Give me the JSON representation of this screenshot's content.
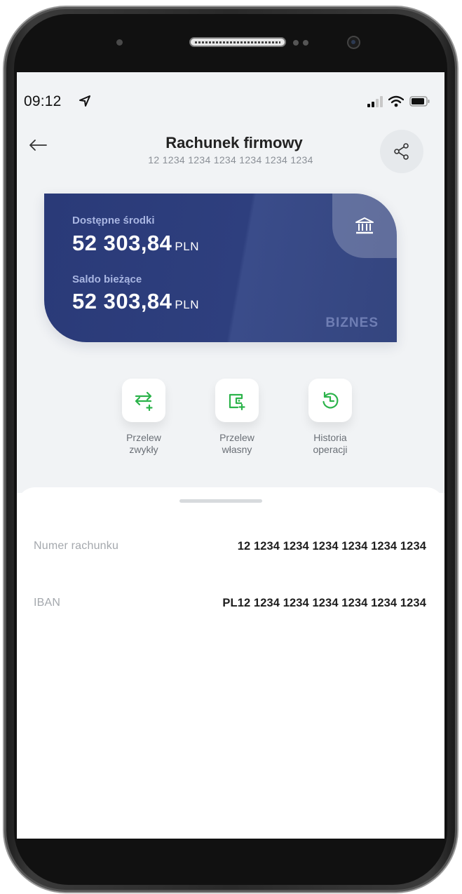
{
  "status_bar": {
    "time": "09:12"
  },
  "header": {
    "title": "Rachunek firmowy",
    "subtitle": "12 1234 1234 1234 1234 1234 1234"
  },
  "card": {
    "available_label": "Dostępne środki",
    "available_amount": "52 303,84",
    "available_currency": "PLN",
    "balance_label": "Saldo bieżące",
    "balance_amount": "52 303,84",
    "balance_currency": "PLN",
    "brand": "BIZNES",
    "colors": {
      "primary": "#2a3a78",
      "accent_text": "#a9b6e2"
    }
  },
  "actions": [
    {
      "label": "Przelew\nzwykły",
      "icon": "transfer-arrows-icon"
    },
    {
      "label": "Przelew\nwłasny",
      "icon": "wallet-icon"
    },
    {
      "label": "Historia\noperacji",
      "icon": "history-icon"
    }
  ],
  "details": {
    "account_number_label": "Numer rachunku",
    "account_number_value": "12 1234 1234 1234 1234 1234 1234",
    "iban_label": "IBAN",
    "iban_value": "PL12 1234 1234 1234 1234 1234 1234"
  },
  "theme": {
    "action_icon_color": "#2bb34a",
    "text_dark": "#222222",
    "text_muted": "#8a8f96"
  }
}
